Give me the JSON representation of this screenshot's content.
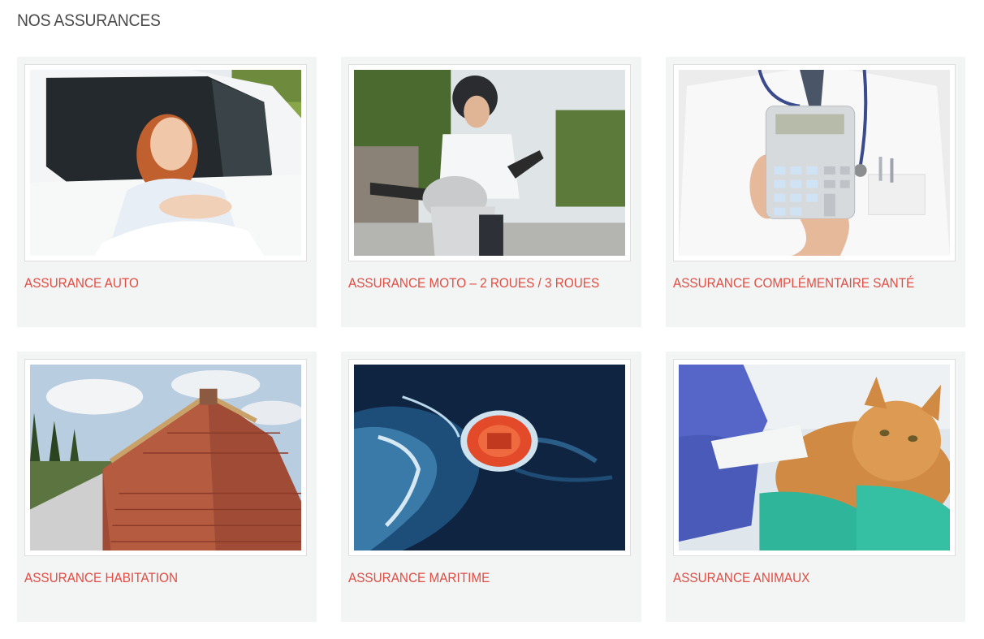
{
  "section": {
    "title": "NOS ASSURANCES"
  },
  "cards": [
    {
      "title": "ASSURANCE AUTO",
      "image": "woman-in-white-car"
    },
    {
      "title": "ASSURANCE MOTO – 2 ROUES / 3 ROUES",
      "image": "woman-on-scooter"
    },
    {
      "title": "ASSURANCE COMPLÉMENTAIRE SANTÉ",
      "image": "doctor-holding-calculator"
    },
    {
      "title": "ASSURANCE HABITATION",
      "image": "tiled-roof-under-construction"
    },
    {
      "title": "ASSURANCE MARITIME",
      "image": "life-raft-in-ocean"
    },
    {
      "title": "ASSURANCE ANIMAUX",
      "image": "bandaged-cat-at-vet"
    }
  ],
  "colors": {
    "card_bg": "#f3f4f4",
    "link": "#e04d43",
    "title": "#4a4a4a"
  }
}
